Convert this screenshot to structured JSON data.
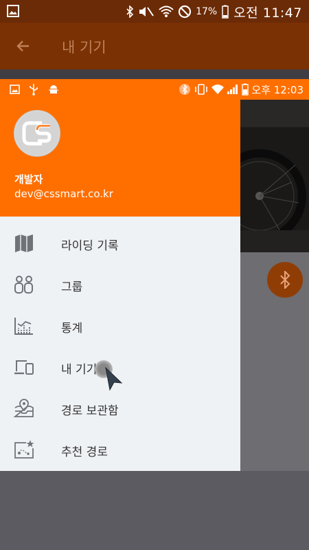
{
  "outer_status": {
    "battery_pct": "17%",
    "time": "오전 11:47"
  },
  "outer_appbar": {
    "title": "내 기기"
  },
  "inner_status": {
    "time": "오후 12:03"
  },
  "drawer": {
    "user_name": "개발자",
    "user_email": "dev@cssmart.co.kr",
    "items": [
      {
        "label": "라이딩 기록",
        "icon": "map-icon"
      },
      {
        "label": "그룹",
        "icon": "group-icon"
      },
      {
        "label": "통계",
        "icon": "statistics-icon"
      },
      {
        "label": "내 기기",
        "icon": "device-icon"
      },
      {
        "label": "경로 보관함",
        "icon": "route-archive-icon"
      },
      {
        "label": "추천 경로",
        "icon": "recommended-route-icon"
      }
    ]
  },
  "colors": {
    "accent": "#ff6f00",
    "drawer_bg": "#eff2f5"
  }
}
